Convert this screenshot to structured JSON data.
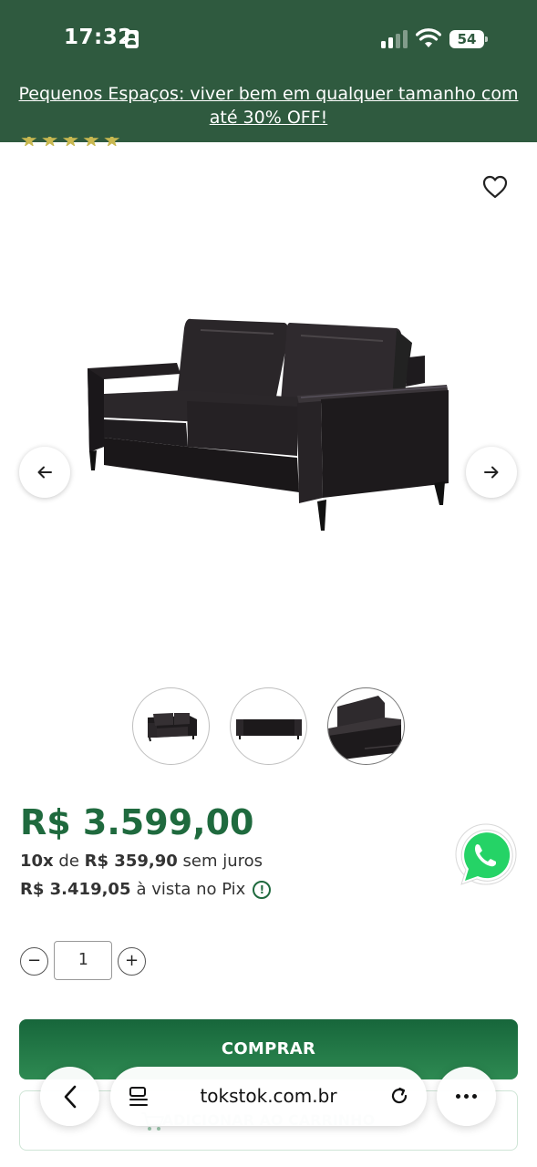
{
  "status_bar": {
    "time": "17:32",
    "battery": "54",
    "signal_bars": 2
  },
  "promo": {
    "text": "Pequenos Espaços: viver bem em qualquer tamanho com até 30% OFF!"
  },
  "rating_peek": "★★★★★",
  "gallery": {
    "favorite_icon": "heart-icon",
    "prev_icon": "arrow-left-icon",
    "next_icon": "arrow-right-icon",
    "thumbnails": [
      "sofa-front",
      "sofa-back",
      "sofa-detail"
    ],
    "selected_thumbnail": 3
  },
  "pricing": {
    "price": "R$ 3.599,00",
    "installments_count": "10x",
    "installments_word": "de",
    "installments_value": "R$ 359,90",
    "installments_suffix": "sem juros",
    "pix_price": "R$ 3.419,05",
    "pix_suffix": "à vista no Pix"
  },
  "quantity": {
    "minus": "−",
    "value": "1",
    "plus": "+"
  },
  "actions": {
    "buy_label": "COMPRAR",
    "cart_label": "ADICIONAR AO CARRINHO"
  },
  "browser": {
    "url": "tokstok.com.br"
  },
  "colors": {
    "header_green": "#2f5a3f",
    "price_green": "#1f6a3e",
    "whatsapp_green": "#25d366"
  }
}
